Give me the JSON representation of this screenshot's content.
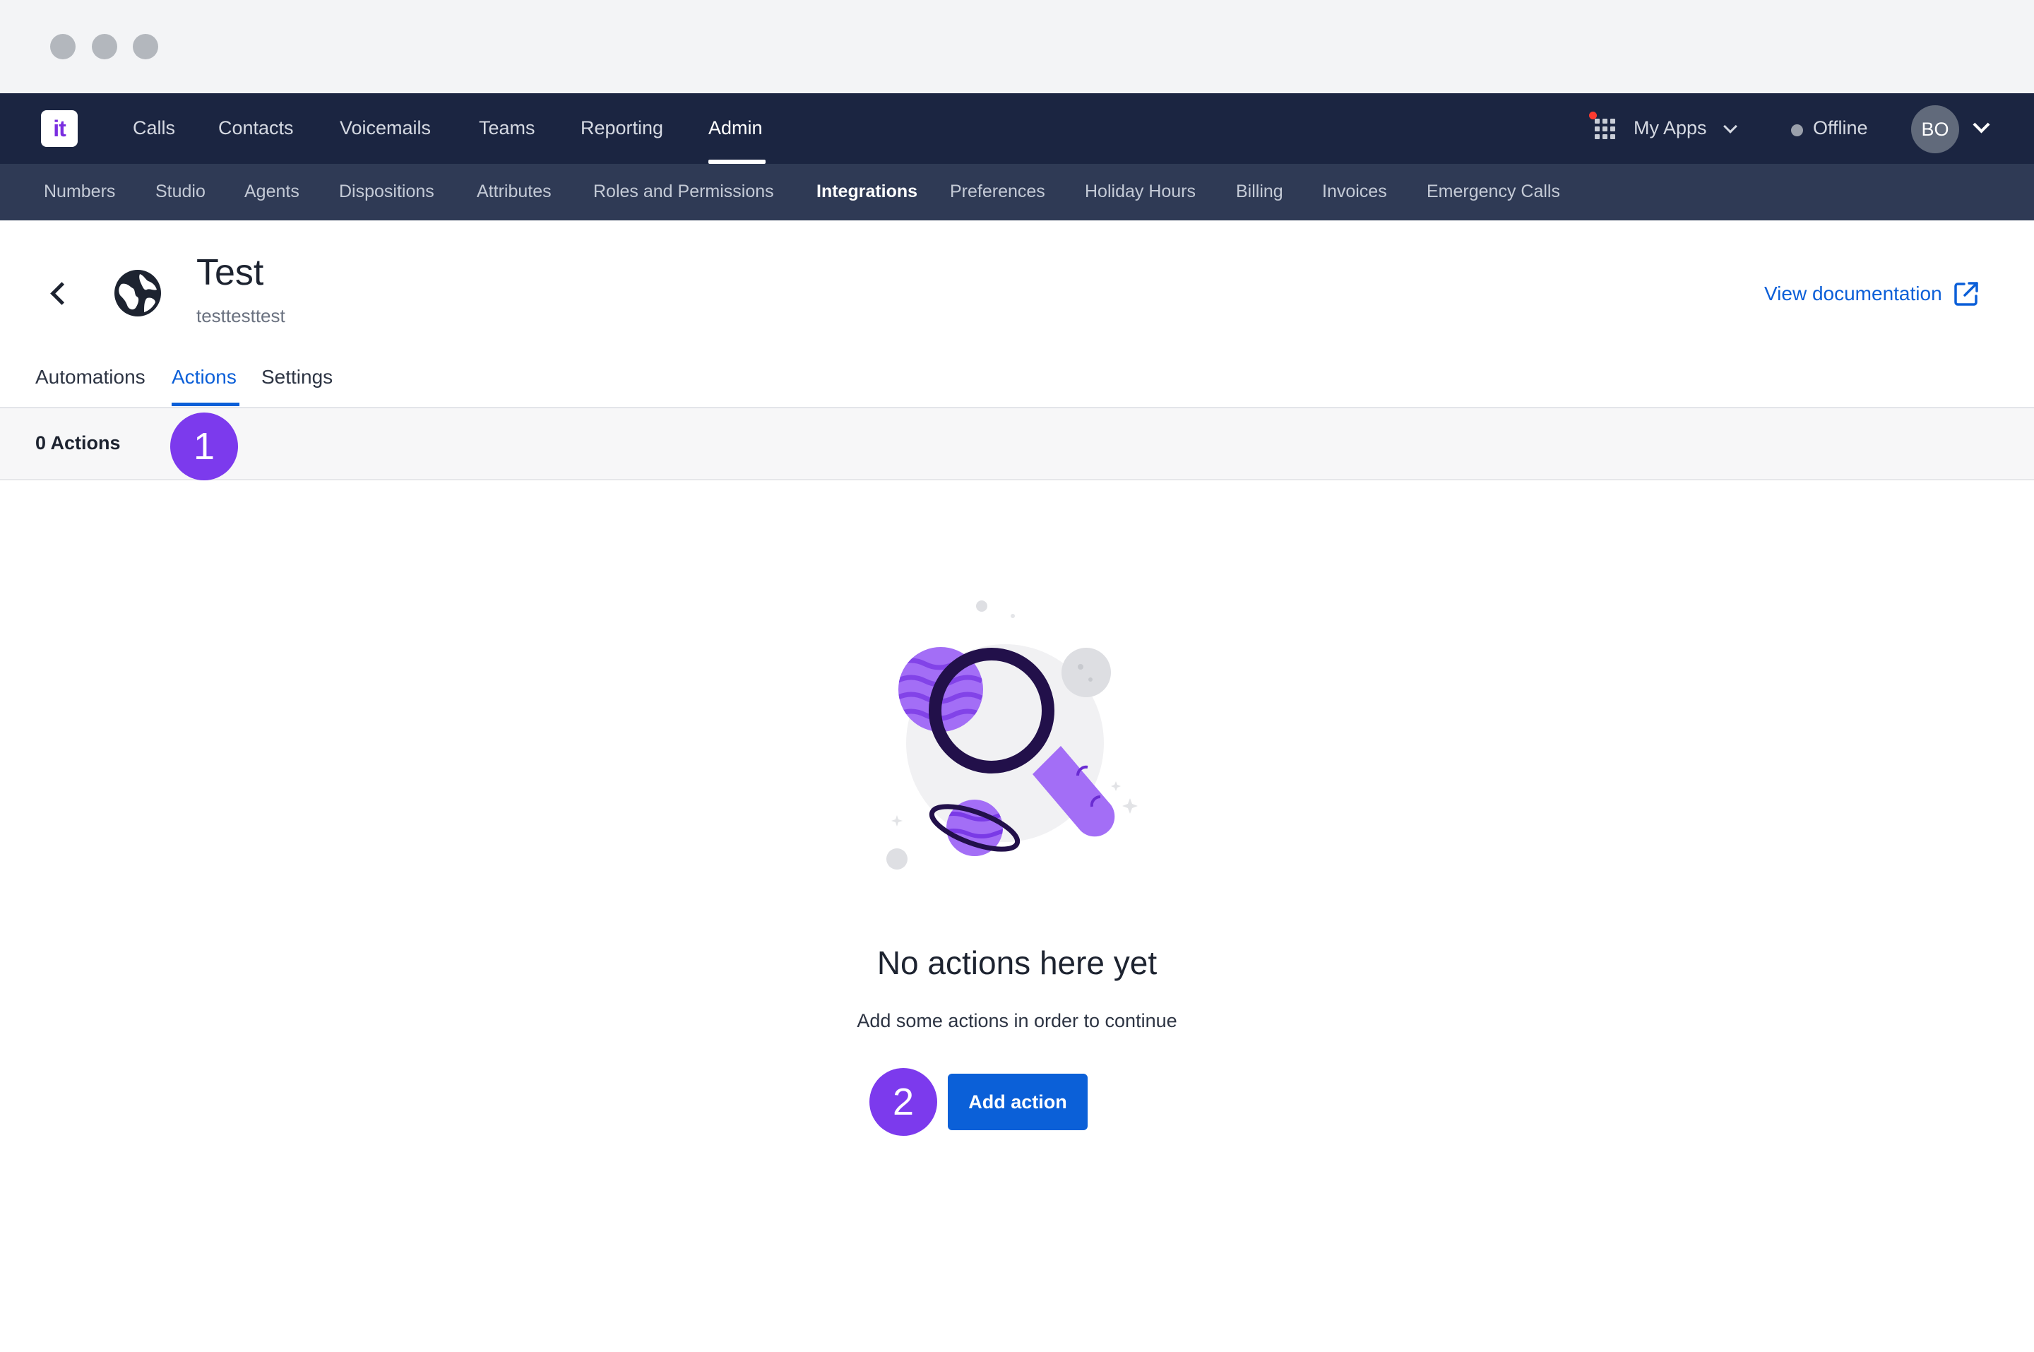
{
  "topnav": {
    "logo_text": "it",
    "items": [
      "Calls",
      "Contacts",
      "Voicemails",
      "Teams",
      "Reporting",
      "Admin"
    ],
    "active_item": "Admin",
    "apps_label": "My Apps",
    "status_label": "Offline",
    "avatar_initials": "BO"
  },
  "subnav": {
    "items": [
      "Numbers",
      "Studio",
      "Agents",
      "Dispositions",
      "Attributes",
      "Roles and Permissions",
      "Integrations",
      "Preferences",
      "Holiday Hours",
      "Billing",
      "Invoices",
      "Emergency Calls"
    ],
    "active_item": "Integrations"
  },
  "header": {
    "title": "Test",
    "subtitle": "testtesttest",
    "doc_link": "View documentation"
  },
  "tabs": [
    "Automations",
    "Actions",
    "Settings"
  ],
  "active_tab": "Actions",
  "count_label": "0 Actions",
  "markers": [
    "1",
    "2"
  ],
  "empty_state": {
    "title": "No actions here yet",
    "subtitle": "Add some actions in order to continue",
    "button_label": "Add action"
  },
  "colors": {
    "topnav_bg": "#1b2541",
    "subnav_bg": "#2f3a55",
    "accent_blue": "#0b5fd8",
    "marker_purple": "#7c3aed",
    "notification_red": "#ff3b30"
  },
  "icons": [
    "back-arrow-icon",
    "globe-icon",
    "external-link-icon",
    "apps-grid-icon",
    "chevron-down-icon",
    "status-dot-icon",
    "magnifier-illustration"
  ]
}
